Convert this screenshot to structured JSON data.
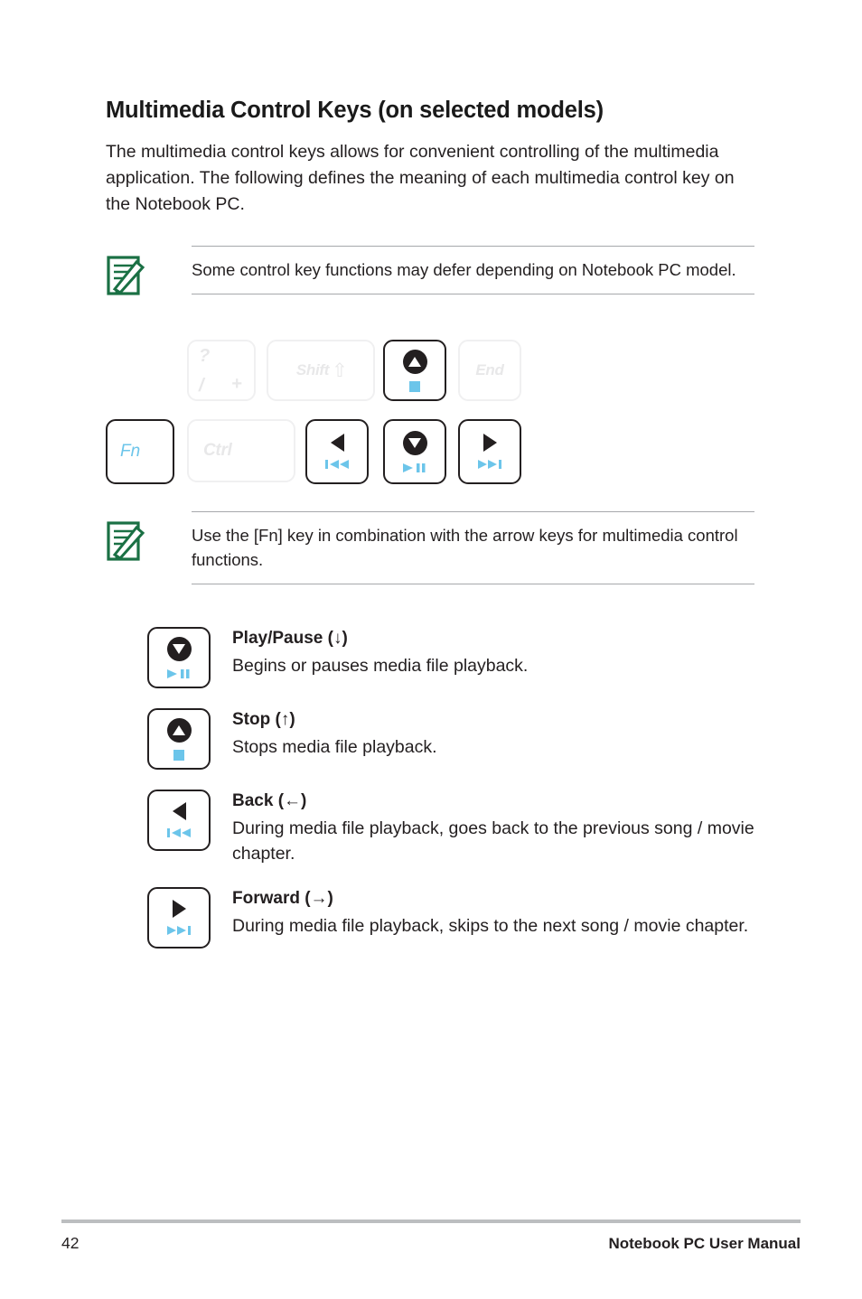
{
  "page": {
    "title": "Multimedia Control Keys (on selected models)",
    "intro": "The multimedia control keys allows for convenient controlling of the multimedia application. The following defines the meaning of each multimedia control key on the Notebook PC."
  },
  "notes": [
    {
      "icon": "note-pencil-icon",
      "text": "Some control key functions may defer depending on Notebook PC model."
    },
    {
      "icon": "note-pencil-icon",
      "text": "Use the [Fn] key in combination with the arrow keys for multimedia control functions."
    }
  ],
  "keyboard": {
    "keys": [
      {
        "id": "key-slash",
        "primary": "?",
        "secondary": "/",
        "tertiary": "+",
        "state": "inactive"
      },
      {
        "id": "key-shift",
        "label": "Shift",
        "glyph": "shift-arrow-up-icon",
        "state": "inactive"
      },
      {
        "id": "key-stop",
        "label": "",
        "glyph": "stop-circle-up-triangle-icon",
        "media": "stop-square-icon",
        "state": "active"
      },
      {
        "id": "key-end",
        "label": "End",
        "state": "inactive"
      },
      {
        "id": "key-fn",
        "label": "Fn",
        "state": "active"
      },
      {
        "id": "key-ctrl",
        "label": "Ctrl",
        "state": "inactive"
      },
      {
        "id": "key-back",
        "glyph": "triangle-left-icon",
        "media": "previous-track-icon",
        "state": "active"
      },
      {
        "id": "key-play",
        "glyph": "circle-down-triangle-icon",
        "media": "play-pause-icon",
        "state": "active"
      },
      {
        "id": "key-fwd",
        "glyph": "triangle-right-icon",
        "media": "next-track-icon",
        "state": "active"
      }
    ]
  },
  "descriptions": [
    {
      "key_icon": "play-pause-key-icon",
      "title": "Play/Pause (↓)",
      "body": "Begins or pauses media file playback."
    },
    {
      "key_icon": "stop-key-icon",
      "title": "Stop (↑)",
      "body": "Stops media file playback."
    },
    {
      "key_icon": "back-key-icon",
      "title": "Back (←)",
      "body": "During media file playback, goes back to the previous song / movie chapter."
    },
    {
      "key_icon": "forward-key-icon",
      "title": "Forward (→)",
      "body": "During media file playback, skips to the next song / movie chapter."
    }
  ],
  "footer": {
    "page_number": "42",
    "manual_title": "Notebook PC User Manual"
  },
  "colors": {
    "accent_blue": "#6cc5ea",
    "note_green": "#1a7044",
    "text": "#231f20",
    "dim_key": "#e8e8e9",
    "rule_gray": "#a6a8ab",
    "footer_rule": "#bcbec0"
  }
}
